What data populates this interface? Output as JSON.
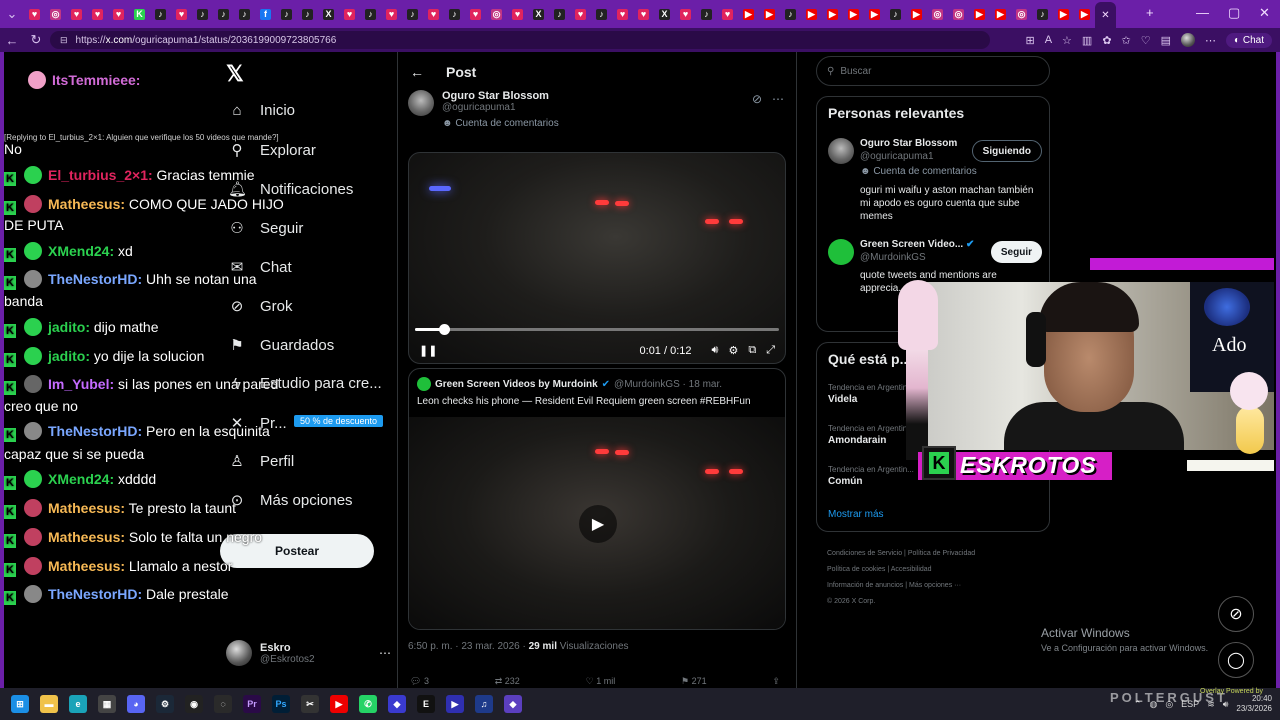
{
  "browser": {
    "url_prefix": "https://",
    "url_domain": "x.com",
    "url_path": "/oguricapuma1/status/2036199009723805766",
    "chat_label": "Chat",
    "tabs": [
      {
        "color": "#e0245e",
        "glyph": "♥"
      },
      {
        "color": "#c13584",
        "glyph": "◎"
      },
      {
        "color": "#e0245e",
        "glyph": "♥"
      },
      {
        "color": "#e0245e",
        "glyph": "♥"
      },
      {
        "color": "#e0245e",
        "glyph": "♥"
      },
      {
        "color": "#2bd14f",
        "glyph": "K"
      },
      {
        "color": "#222",
        "glyph": "♪"
      },
      {
        "color": "#e0245e",
        "glyph": "♥"
      },
      {
        "color": "#222",
        "glyph": "♪"
      },
      {
        "color": "#222",
        "glyph": "♪"
      },
      {
        "color": "#222",
        "glyph": "♪"
      },
      {
        "color": "#1877f2",
        "glyph": "f"
      },
      {
        "color": "#222",
        "glyph": "♪"
      },
      {
        "color": "#222",
        "glyph": "♪"
      },
      {
        "color": "#222",
        "glyph": "X"
      },
      {
        "color": "#e0245e",
        "glyph": "♥"
      },
      {
        "color": "#222",
        "glyph": "♪"
      },
      {
        "color": "#e0245e",
        "glyph": "♥"
      },
      {
        "color": "#222",
        "glyph": "♪"
      },
      {
        "color": "#e0245e",
        "glyph": "♥"
      },
      {
        "color": "#222",
        "glyph": "♪"
      },
      {
        "color": "#e0245e",
        "glyph": "♥"
      },
      {
        "color": "#c13584",
        "glyph": "◎"
      },
      {
        "color": "#e0245e",
        "glyph": "♥"
      },
      {
        "color": "#222",
        "glyph": "X"
      },
      {
        "color": "#222",
        "glyph": "♪"
      },
      {
        "color": "#e0245e",
        "glyph": "♥"
      },
      {
        "color": "#222",
        "glyph": "♪"
      },
      {
        "color": "#e0245e",
        "glyph": "♥"
      },
      {
        "color": "#e0245e",
        "glyph": "♥"
      },
      {
        "color": "#222",
        "glyph": "X"
      },
      {
        "color": "#e0245e",
        "glyph": "♥"
      },
      {
        "color": "#222",
        "glyph": "♪"
      },
      {
        "color": "#e0245e",
        "glyph": "♥"
      },
      {
        "color": "#e00",
        "glyph": "▶"
      },
      {
        "color": "#e00",
        "glyph": "▶"
      },
      {
        "color": "#222",
        "glyph": "♪"
      },
      {
        "color": "#e00",
        "glyph": "▶"
      },
      {
        "color": "#e00",
        "glyph": "▶"
      },
      {
        "color": "#e00",
        "glyph": "▶"
      },
      {
        "color": "#e00",
        "glyph": "▶"
      },
      {
        "color": "#222",
        "glyph": "♪"
      },
      {
        "color": "#e00",
        "glyph": "▶"
      },
      {
        "color": "#c13584",
        "glyph": "◎"
      },
      {
        "color": "#c13584",
        "glyph": "◎"
      },
      {
        "color": "#e00",
        "glyph": "▶"
      },
      {
        "color": "#e00",
        "glyph": "▶"
      },
      {
        "color": "#c13584",
        "glyph": "◎"
      },
      {
        "color": "#222",
        "glyph": "♪"
      },
      {
        "color": "#e00",
        "glyph": "▶"
      },
      {
        "color": "#e00",
        "glyph": "▶"
      }
    ]
  },
  "nav": {
    "items": [
      "Inicio",
      "Explorar",
      "Notificaciones",
      "Seguir",
      "Chat",
      "Grok",
      "Guardados",
      "Estudio para cre...",
      "Pr...",
      "Perfil",
      "Más opciones"
    ],
    "promo": "50 % de descuento",
    "post_button": "Postear",
    "account_name": "Eskro",
    "account_handle": "@Eskrotos2"
  },
  "post": {
    "header": "Post",
    "author_name": "Oguro Star Blossom",
    "author_handle": "@oguricapuma1",
    "author_badge": "Cuenta de comentarios",
    "video_time": "0:01 / 0:12",
    "video_progress": 0.08,
    "quote_name": "Green Screen Videos by Murdoink",
    "quote_handle": "@MurdoinkGS · 18 mar.",
    "quote_text": "Leon checks his phone — Resident Evil Requiem green screen #REBHFun",
    "meta_time": "6:50 p. m. · 23 mar. 2026 ·",
    "meta_views_count": "29 mil",
    "meta_views_label": "Visualizaciones",
    "actions": [
      "3",
      "232",
      "1 mil",
      "271"
    ]
  },
  "sidebar": {
    "search_placeholder": "Buscar",
    "relevant_title": "Personas relevantes",
    "people": [
      {
        "name": "Oguro Star Blossom",
        "handle": "@oguricapuma1",
        "badge": "Cuenta de comentarios",
        "bio": "oguri mi waifu y aston machan también mi apodo es oguro cuenta que sube memes",
        "button": "Siguiendo"
      },
      {
        "name": "Green Screen Video...",
        "handle": "@MurdoinkGS",
        "bio": "quote tweets and mentions are apprecia... Fortnite... buy me...",
        "button": "Seguir"
      }
    ],
    "trends_title": "Qué está p...",
    "trends": [
      {
        "context": "Tendencia en Argentin...",
        "title": "Videla"
      },
      {
        "context": "Tendencia en Argentin...",
        "title": "Amondarain"
      },
      {
        "context": "Tendencia en Argentin...",
        "title": "Común"
      }
    ],
    "show_more": "Mostrar más",
    "footer": [
      "Condiciones de Servicio",
      "Política de Privacidad",
      "Política de cookies",
      "Accesibilidad",
      "Información de anuncios",
      "Más opciones ···",
      "© 2026 X Corp."
    ]
  },
  "chat": {
    "reply_line": "[Replying to El_turbius_2×1: Alguien que verifique los 50 videos que mande?]",
    "messages": [
      {
        "user": "ItsTemmieee:",
        "color": "#d16bd6",
        "text": "",
        "avatar": "#f0a0c8",
        "k": false
      },
      {
        "user": "",
        "color": "#fff",
        "text": "No",
        "avatar": "",
        "k": false
      },
      {
        "user": "El_turbius_2×1:",
        "color": "#e0245e",
        "text": " Gracias temmie",
        "avatar": "#2bd14f",
        "k": true
      },
      {
        "user": "Matheesus:",
        "color": "#f7b955",
        "text": " COMO QUE JADO HIJO",
        "avatar": "#c04060",
        "k": true
      },
      {
        "user": "",
        "color": "#fff",
        "text": "DE PUTA",
        "avatar": "",
        "k": false
      },
      {
        "user": "XMend24:",
        "color": "#2bd14f",
        "text": " xd",
        "avatar": "#2bd14f",
        "k": true
      },
      {
        "user": "TheNestorHD:",
        "color": "#7aa7ff",
        "text": " Uhh se notan una",
        "avatar": "#888",
        "k": true
      },
      {
        "user": "",
        "color": "#fff",
        "text": "banda",
        "avatar": "",
        "k": false
      },
      {
        "user": "jadito:",
        "color": "#2bd14f",
        "text": " dijo mathe",
        "avatar": "#2bd14f",
        "k": true
      },
      {
        "user": "jadito:",
        "color": "#2bd14f",
        "text": " yo dije la solucion",
        "avatar": "#2bd14f",
        "k": true
      },
      {
        "user": "Im_Yubel:",
        "color": "#c46bff",
        "text": " si las pones en una pared",
        "avatar": "#666",
        "k": true
      },
      {
        "user": "",
        "color": "#fff",
        "text": "creo que no",
        "avatar": "",
        "k": false
      },
      {
        "user": "TheNestorHD:",
        "color": "#7aa7ff",
        "text": " Pero en la esquinita",
        "avatar": "#888",
        "k": true
      },
      {
        "user": "",
        "color": "#fff",
        "text": "capaz que si se pueda",
        "avatar": "",
        "k": false
      },
      {
        "user": "XMend24:",
        "color": "#2bd14f",
        "text": " xdddd",
        "avatar": "#2bd14f",
        "k": true
      },
      {
        "user": "Matheesus:",
        "color": "#f7b955",
        "text": " Te presto la taunt",
        "avatar": "#c04060",
        "k": true
      },
      {
        "user": "Matheesus:",
        "color": "#f7b955",
        "text": " Solo te falta un negro",
        "avatar": "#c04060",
        "k": true
      },
      {
        "user": "Matheesus:",
        "color": "#f7b955",
        "text": " Llamalo a nestor",
        "avatar": "#c04060",
        "k": true
      },
      {
        "user": "TheNestorHD:",
        "color": "#7aa7ff",
        "text": " Dale prestale",
        "avatar": "#888",
        "k": true
      }
    ]
  },
  "stream": {
    "streamer_name": "ESKROTOS",
    "poster_text": "Ado",
    "k_logo": "K"
  },
  "windows": {
    "activate_title": "Activar Windows",
    "activate_sub": "Ve a Configuración para activar Windows.",
    "overlay_brand": "POLTERGUST",
    "overlay_powered": "Overlay Powered by",
    "clock_time": "20:40",
    "clock_date": "23/3/2026",
    "lang": "ESP"
  }
}
